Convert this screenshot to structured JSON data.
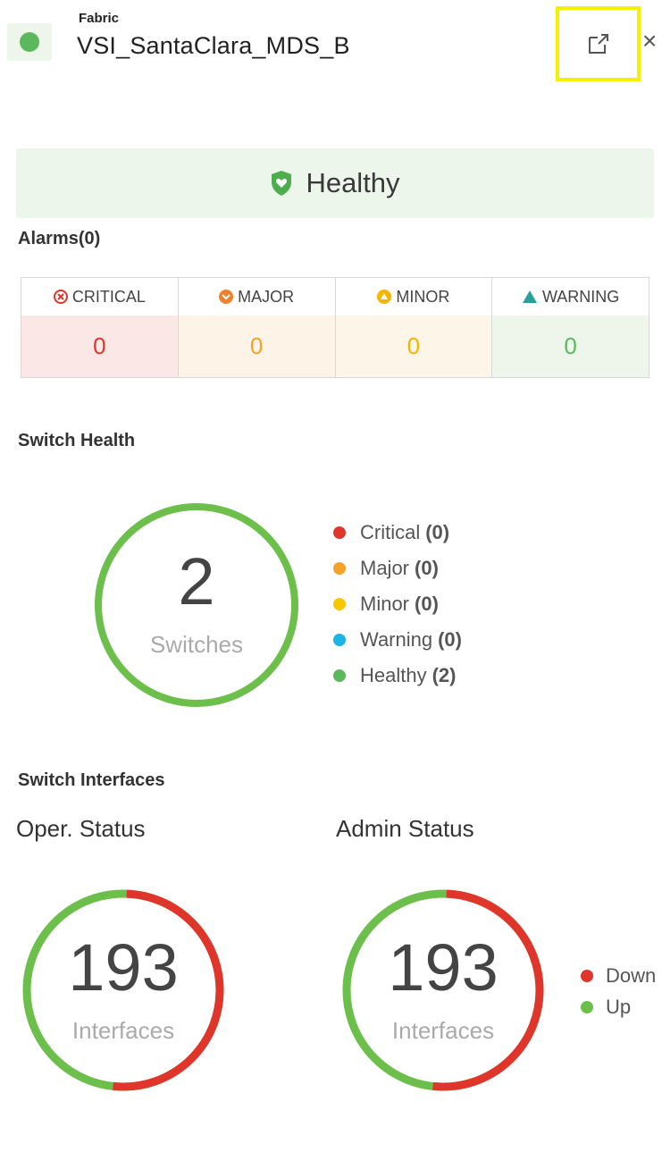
{
  "header": {
    "type_label": "Fabric",
    "title": "VSI_SantaClara_MDS_B",
    "status_color": "#5cb85c"
  },
  "health_banner": {
    "label": "Healthy",
    "icon": "shield-heart-icon",
    "color": "#4cae4c"
  },
  "alarms": {
    "title": "Alarms(0)",
    "columns": [
      {
        "label": "CRITICAL",
        "value": "0",
        "icon": "critical-x-icon",
        "color": "#e0352b",
        "bg": "#fbe7e6"
      },
      {
        "label": "MAJOR",
        "value": "0",
        "icon": "major-chevron-icon",
        "color": "#f0812a",
        "bg": "#fdf4e7"
      },
      {
        "label": "MINOR",
        "value": "0",
        "icon": "minor-alert-icon",
        "color": "#f7b500",
        "bg": "#fdf6e8"
      },
      {
        "label": "WARNING",
        "value": "0",
        "icon": "warning-triangle-icon",
        "color": "#2aa198",
        "bg": "#eef5ea"
      }
    ]
  },
  "switch_health": {
    "title": "Switch Health",
    "count": "2",
    "unit": "Switches",
    "legend": [
      {
        "label": "Critical",
        "count": "(0)",
        "color": "#e0352b"
      },
      {
        "label": "Major",
        "count": "(0)",
        "color": "#f7a12a"
      },
      {
        "label": "Minor",
        "count": "(0)",
        "color": "#f7c800"
      },
      {
        "label": "Warning",
        "count": "(0)",
        "color": "#1ab4e8"
      },
      {
        "label": "Healthy",
        "count": "(2)",
        "color": "#5cb85c"
      }
    ],
    "healthy_fraction": 1.0
  },
  "switch_interfaces": {
    "title": "Switch Interfaces",
    "oper": {
      "title": "Oper. Status",
      "count": "193",
      "unit": "Interfaces",
      "down_fraction": 0.52
    },
    "admin": {
      "title": "Admin Status",
      "count": "193",
      "unit": "Interfaces",
      "down_fraction": 0.52
    },
    "legend": [
      {
        "label": "Down",
        "color": "#e0352b"
      },
      {
        "label": "Up",
        "color": "#6cbf4a"
      }
    ]
  }
}
